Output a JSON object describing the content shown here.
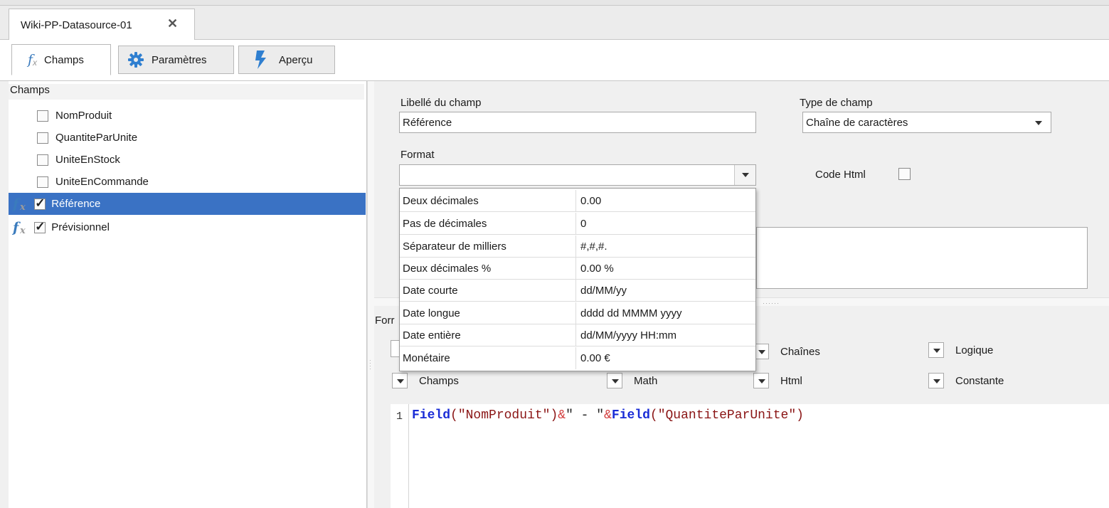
{
  "document_tab": {
    "title": "Wiki-PP-Datasource-01"
  },
  "tabs": [
    {
      "label": "Champs",
      "icon": "fx-icon"
    },
    {
      "label": "Paramètres",
      "icon": "gear-icon"
    },
    {
      "label": "Aperçu",
      "icon": "lightning-icon"
    }
  ],
  "fields_panel": {
    "header": "Champs",
    "items": [
      {
        "label": "NomProduit",
        "checked": false,
        "formula": false
      },
      {
        "label": "QuantiteParUnite",
        "checked": false,
        "formula": false
      },
      {
        "label": "UniteEnStock",
        "checked": false,
        "formula": false
      },
      {
        "label": "UniteEnCommande",
        "checked": false,
        "formula": false
      },
      {
        "label": "Référence",
        "checked": true,
        "formula": true
      },
      {
        "label": "Prévisionnel",
        "checked": true,
        "formula": true
      }
    ]
  },
  "field_props": {
    "label_caption": "Libellé du champ",
    "label_value": "Référence",
    "type_caption": "Type de champ",
    "type_value": "Chaîne de caractères",
    "format_caption": "Format",
    "format_value": "",
    "code_html_caption": "Code Html"
  },
  "format_options": [
    {
      "name": "Deux décimales",
      "value": "0.00"
    },
    {
      "name": "Pas de décimales",
      "value": "0"
    },
    {
      "name": "Séparateur de milliers",
      "value": "#,#,#."
    },
    {
      "name": "Deux décimales %",
      "value": "0.00 %"
    },
    {
      "name": "Date courte",
      "value": "dd/MM/yy"
    },
    {
      "name": "Date longue",
      "value": "dddd dd MMMM yyyy"
    },
    {
      "name": "Date entière",
      "value": "dd/MM/yyyy HH:mm"
    },
    {
      "name": "Monétaire",
      "value": "0.00 €"
    }
  ],
  "formula": {
    "caption_partial": "Forr",
    "buttons_row1": [
      "Chaînes",
      "Logique"
    ],
    "buttons_row2": [
      "Champs",
      "Math",
      "Html",
      "Constante"
    ],
    "line_number": "1",
    "code": {
      "f1": "Field",
      "a1": "(\"NomProduit\")",
      "amp1": "&",
      "mid": "\" - \"",
      "amp2": "&",
      "f2": "Field",
      "a2": "(\"QuantiteParUnite\")"
    }
  }
}
